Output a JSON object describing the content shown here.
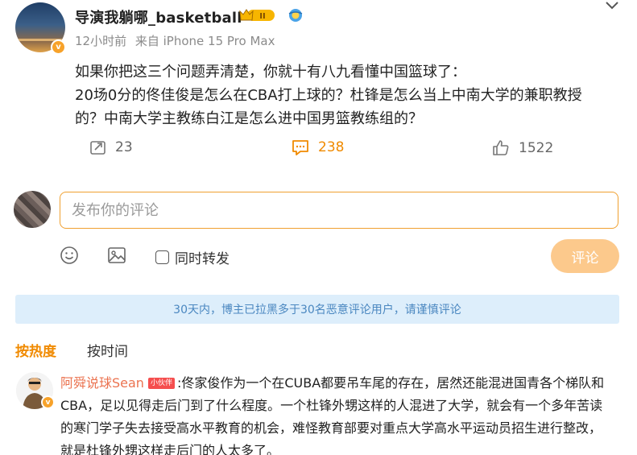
{
  "post": {
    "author": "导演我躺哪_basketball",
    "crown_badge_text": "II",
    "time": "12小时前",
    "source": "来自 iPhone 15 Pro Max",
    "text_lines": [
      "如果你把这三个问题弄清楚，你就十有八九看懂中国篮球了：",
      "20场0分的佟佳俊是怎么在CBA打上球的？杜锋是怎么当上中南大学的兼职教授",
      "的？中南大学主教练白江是怎么进中国男篮教练组的？"
    ],
    "repost_count": "23",
    "comment_count": "238",
    "like_count": "1522"
  },
  "composer": {
    "placeholder": "发布你的评论",
    "repost_label": "同时转发",
    "submit_label": "评论"
  },
  "notice": "30天内，博主已拉黑多于30名恶意评论用户，请谨慎评论",
  "sort": {
    "hot_label": "按热度",
    "time_label": "按时间"
  },
  "comments": [
    {
      "name": "阿舜说球Sean",
      "tag": "小伙伴",
      "lines": [
        ":佟家俊作为一个在CUBA都要吊车尾的存在，居然还能混进国青各个梯队和",
        "CBA，足以见得走后门到了什么程度。一个杜锋外甥这样的人混进了大学，就会有一个多年苦读",
        "的寒门学子失去接受高水平教育的机会，难怪教育部要对重点大学高水平运动员招生进行整改，",
        "就是杜锋外甥这样走后门的人太多了。"
      ]
    }
  ],
  "colors": {
    "accent": "#f08a00",
    "input_border": "#f0a030",
    "submit_bg": "#fcc98c",
    "notice_bg": "#ddeefb",
    "notice_text": "#4a87c0",
    "commenter_name": "#eb7350"
  }
}
